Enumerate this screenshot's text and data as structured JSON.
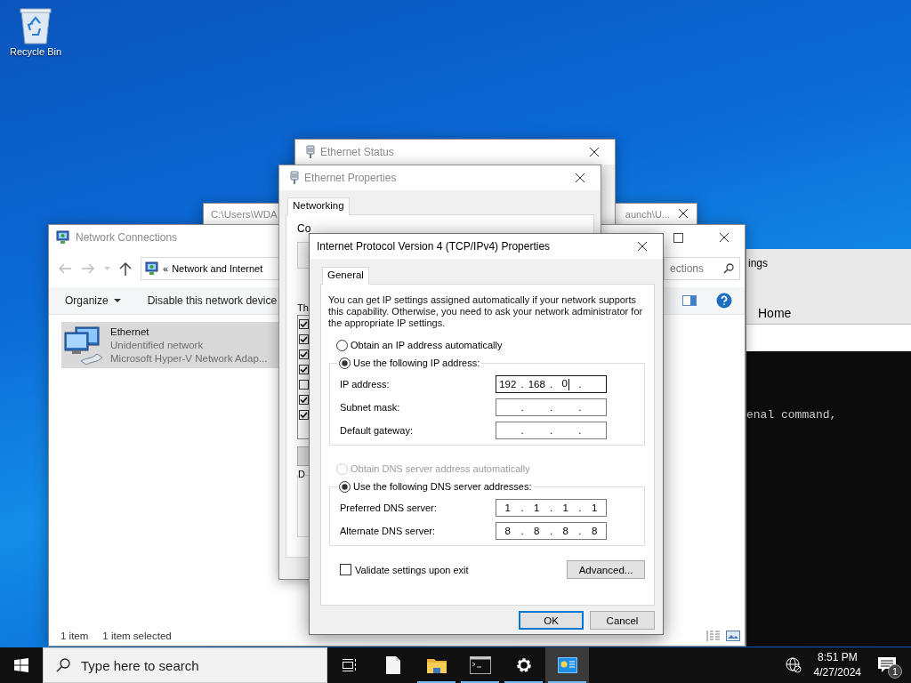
{
  "desktop_icons": [
    {
      "label": "Recycle Bin"
    }
  ],
  "console_window": {
    "title_start": "C:\\Users\\WDA",
    "title_end": "aunch\\U..."
  },
  "settings_window": {
    "title": "ings",
    "tab": "Home",
    "console_line": "enal command,"
  },
  "ethernet_status": {
    "title": "Ethernet Status"
  },
  "ethernet_properties": {
    "title": "Ethernet Properties",
    "tabs": [
      {
        "label": "Networking",
        "selected": true
      }
    ],
    "connect_label": "Co",
    "components_label": "Th",
    "description_label": "D",
    "components": [
      {
        "checked": true
      },
      {
        "checked": true
      },
      {
        "checked": true
      },
      {
        "checked": true
      },
      {
        "checked": false
      },
      {
        "checked": true
      },
      {
        "checked": true
      }
    ]
  },
  "network_connections": {
    "title": "Network Connections",
    "address": {
      "chevron": "«",
      "path": "Network and Internet"
    },
    "search": {
      "placeholder": "ections"
    },
    "toolbar": [
      {
        "label": "Organize",
        "dropdown": true
      },
      {
        "label": "Disable this network device",
        "dropdown": false
      }
    ],
    "items": [
      {
        "name": "Ethernet",
        "status": "Unidentified network",
        "device": "Microsoft Hyper-V Network Adap...",
        "selected": true
      }
    ],
    "status_bar": [
      "1 item",
      "1 item selected"
    ]
  },
  "ipv4_dialog": {
    "title": "Internet Protocol Version 4 (TCP/IPv4) Properties",
    "tabs": [
      {
        "label": "General",
        "selected": true
      }
    ],
    "intro": "You can get IP settings assigned automatically if your network supports this capability. Otherwise, you need to ask your network administrator for the appropriate IP settings.",
    "separator": ".",
    "ip_mode": [
      {
        "label": "Obtain an IP address automatically",
        "selected": false,
        "disabled": false
      },
      {
        "label": "Use the following IP address:",
        "selected": true,
        "disabled": false
      }
    ],
    "ip_fields": [
      {
        "label": "IP address:",
        "octets": [
          "192",
          "168",
          "0"
        ],
        "focused": true
      },
      {
        "label": "Subnet mask:",
        "focused": false
      },
      {
        "label": "Default gateway:",
        "focused": false
      }
    ],
    "dns_mode": [
      {
        "label": "Obtain DNS server address automatically",
        "selected": false,
        "disabled": true
      },
      {
        "label": "Use the following DNS server addresses:",
        "selected": true,
        "disabled": false
      }
    ],
    "dns_fields": [
      {
        "label": "Preferred DNS server:",
        "octets": [
          "1",
          "1",
          "1",
          "1"
        ],
        "focused": false
      },
      {
        "label": "Alternate DNS server:",
        "octets": [
          "8",
          "8",
          "8",
          "8"
        ],
        "focused": false
      }
    ],
    "validate": {
      "label": "Validate settings upon exit",
      "checked": false
    },
    "advanced_button": "Advanced...",
    "footer_buttons": [
      {
        "label": "OK",
        "default": true
      },
      {
        "label": "Cancel",
        "default": false
      }
    ]
  },
  "taskbar": {
    "search": {
      "placeholder": "Type here to search"
    },
    "apps": [
      {
        "kind": "task-view",
        "running": false,
        "active": false
      },
      {
        "kind": "notepad",
        "running": false,
        "active": false
      },
      {
        "kind": "explorer",
        "running": true,
        "active": false
      },
      {
        "kind": "console",
        "running": true,
        "active": false
      },
      {
        "kind": "settings",
        "running": true,
        "active": false
      },
      {
        "kind": "network",
        "running": true,
        "active": true
      }
    ],
    "clock": {
      "time": "8:51 PM",
      "date": "4/27/2024"
    },
    "notifications": {
      "count": "1"
    }
  }
}
